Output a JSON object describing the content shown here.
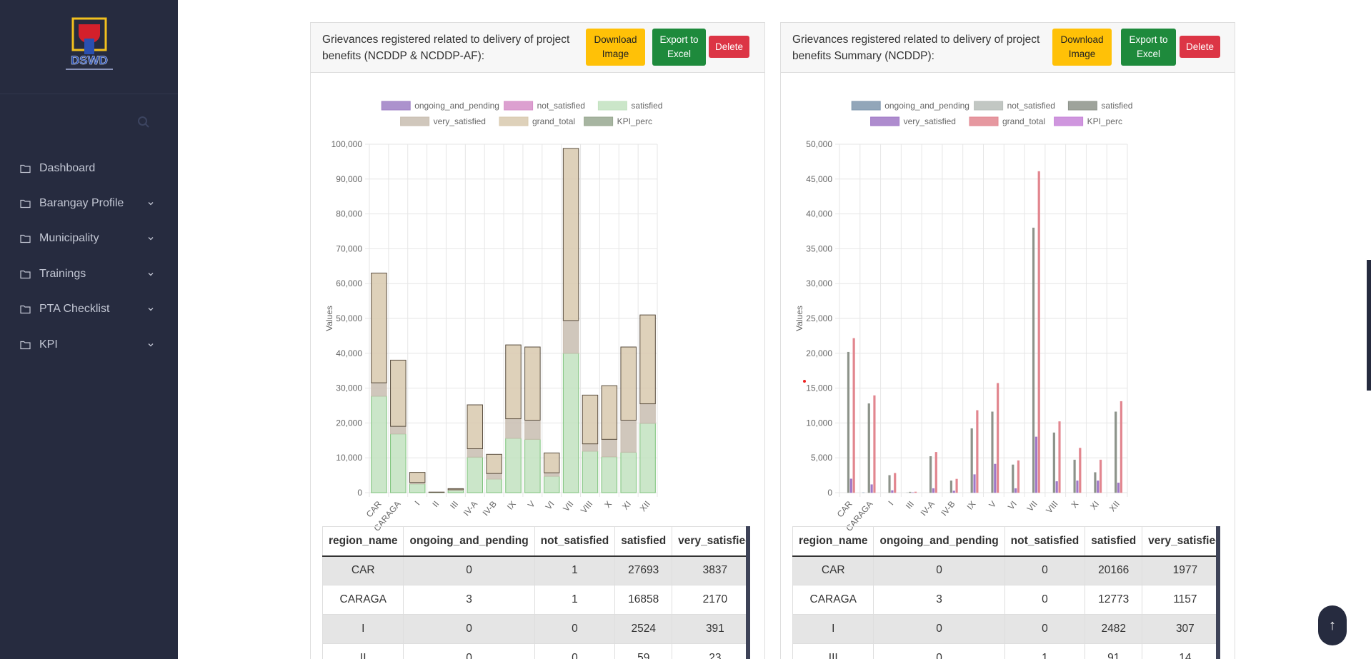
{
  "sidebar": {
    "logo_text": "DSWD",
    "search": {
      "placeholder": "",
      "value": ""
    },
    "items": [
      {
        "label": "Dashboard",
        "has_submenu": false
      },
      {
        "label": "Barangay Profile",
        "has_submenu": true
      },
      {
        "label": "Municipality",
        "has_submenu": true
      },
      {
        "label": "Trainings",
        "has_submenu": true
      },
      {
        "label": "PTA Checklist",
        "has_submenu": true
      },
      {
        "label": "KPI",
        "has_submenu": true
      }
    ]
  },
  "cards": [
    {
      "title": "Grievances registered related to delivery of project benefits (NCDDP & NCDDP-AF):",
      "download_label": "Download Image",
      "export_label": "Export to Excel",
      "delete_label": "Delete",
      "table": {
        "columns": [
          "region_name",
          "ongoing_and_pending",
          "not_satisfied",
          "satisfied",
          "very_satisfied"
        ],
        "rows": [
          [
            "CAR",
            "0",
            "1",
            "27693",
            "3837"
          ],
          [
            "CARAGA",
            "3",
            "1",
            "16858",
            "2170"
          ],
          [
            "I",
            "0",
            "0",
            "2524",
            "391"
          ],
          [
            "II",
            "0",
            "0",
            "59",
            "23"
          ]
        ]
      }
    },
    {
      "title": "Grievances registered related to delivery of project benefits Summary (NCDDP):",
      "download_label": "Download Image",
      "export_label": "Export to Excel",
      "delete_label": "Delete",
      "table": {
        "columns": [
          "region_name",
          "ongoing_and_pending",
          "not_satisfied",
          "satisfied",
          "very_satisfied"
        ],
        "rows": [
          [
            "CAR",
            "0",
            "0",
            "20166",
            "1977"
          ],
          [
            "CARAGA",
            "3",
            "0",
            "12773",
            "1157"
          ],
          [
            "I",
            "0",
            "0",
            "2482",
            "307"
          ],
          [
            "III",
            "0",
            "1",
            "91",
            "14"
          ]
        ]
      }
    }
  ],
  "chart_data": [
    {
      "type": "bar",
      "stacked": true,
      "ylabel": "Values",
      "ylim": [
        0,
        100000
      ],
      "yticks": [
        "0",
        "10,000",
        "20,000",
        "30,000",
        "40,000",
        "50,000",
        "60,000",
        "70,000",
        "80,000",
        "90,000",
        "100,000"
      ],
      "categories": [
        "CAR",
        "CARAGA",
        "I",
        "II",
        "III",
        "IV-A",
        "IV-B",
        "IX",
        "V",
        "VI",
        "VII",
        "VIII",
        "X",
        "XI",
        "XII"
      ],
      "legend_position": "top",
      "series": [
        {
          "name": "ongoing_and_pending",
          "color": "#9e7fc4",
          "values": [
            0,
            3,
            0,
            0,
            0,
            0,
            0,
            0,
            0,
            0,
            0,
            0,
            0,
            0,
            0
          ]
        },
        {
          "name": "not_satisfied",
          "color": "#d68fc8",
          "values": [
            1,
            1,
            0,
            0,
            0,
            0,
            0,
            0,
            0,
            0,
            0,
            0,
            0,
            0,
            0
          ]
        },
        {
          "name": "satisfied",
          "color": "#c2e2c0",
          "values": [
            27693,
            16858,
            2524,
            59,
            700,
            10200,
            3900,
            15600,
            15300,
            4700,
            40000,
            11900,
            10300,
            11600,
            19900
          ]
        },
        {
          "name": "very_satisfied",
          "color": "#c8bdb0",
          "values": [
            3837,
            2170,
            391,
            23,
            150,
            2400,
            1600,
            5600,
            5500,
            1000,
            9400,
            2100,
            5000,
            9200,
            5600
          ]
        },
        {
          "name": "grand_total",
          "color": "#d8c9ae",
          "values": [
            31500,
            19000,
            2900,
            82,
            300,
            12600,
            5500,
            21200,
            21000,
            5700,
            49400,
            14000,
            15400,
            21000,
            25500
          ]
        },
        {
          "name": "KPI_perc",
          "color": "#98a890",
          "values": [
            0,
            0,
            0,
            0,
            0,
            0,
            0,
            0,
            0,
            0,
            0,
            0,
            0,
            0,
            0
          ]
        }
      ]
    },
    {
      "type": "bar",
      "stacked": false,
      "ylabel": "Values",
      "ylim": [
        0,
        50000
      ],
      "yticks": [
        "0",
        "5,000",
        "10,000",
        "15,000",
        "20,000",
        "25,000",
        "30,000",
        "35,000",
        "40,000",
        "45,000",
        "50,000"
      ],
      "categories": [
        "CAR",
        "CARAGA",
        "I",
        "III",
        "IV-A",
        "IV-B",
        "IX",
        "V",
        "VI",
        "VII",
        "VIII",
        "X",
        "XI",
        "XII"
      ],
      "legend_position": "top",
      "series": [
        {
          "name": "ongoing_and_pending",
          "color": "#7f97ad",
          "values": [
            0,
            3,
            0,
            0,
            0,
            0,
            0,
            0,
            0,
            0,
            0,
            0,
            0,
            0
          ]
        },
        {
          "name": "not_satisfied",
          "color": "#b7bdb9",
          "values": [
            0,
            0,
            0,
            1,
            0,
            0,
            0,
            0,
            0,
            0,
            0,
            0,
            0,
            0
          ]
        },
        {
          "name": "satisfied",
          "color": "#8d938a",
          "values": [
            20166,
            12773,
            2482,
            91,
            5200,
            1700,
            9200,
            11600,
            4000,
            38000,
            8600,
            4700,
            2900,
            11600
          ]
        },
        {
          "name": "very_satisfied",
          "color": "#a078c6",
          "values": [
            1977,
            1157,
            307,
            14,
            600,
            250,
            2600,
            4100,
            600,
            8000,
            1600,
            1700,
            1700,
            1400
          ]
        },
        {
          "name": "grand_total",
          "color": "#e2868f",
          "values": [
            22143,
            13933,
            2789,
            106,
            5800,
            1950,
            11800,
            15700,
            4600,
            46100,
            10200,
            6400,
            4700,
            13100
          ]
        },
        {
          "name": "KPI_perc",
          "color": "#c784d8",
          "values": [
            0,
            0,
            0,
            0,
            0,
            0,
            0,
            0,
            0,
            0,
            0,
            0,
            0,
            0
          ]
        }
      ]
    }
  ]
}
